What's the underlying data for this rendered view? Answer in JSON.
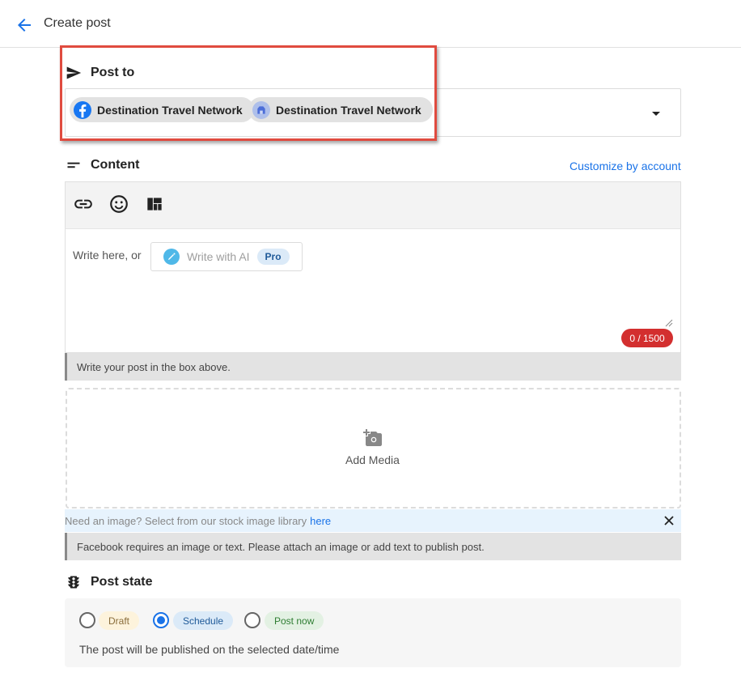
{
  "header": {
    "title": "Create post",
    "back_icon": "arrow-left-icon"
  },
  "post_to": {
    "heading": "Post to",
    "accounts": [
      {
        "name": "Destination Travel Network",
        "network": "facebook",
        "icon": "facebook-icon"
      },
      {
        "name": "Destination Travel Network",
        "network": "google-business",
        "icon": "google-business-icon"
      }
    ]
  },
  "content": {
    "heading": "Content",
    "customize_link": "Customize by account",
    "toolbar": [
      "link-icon",
      "emoji-icon",
      "layout-icon"
    ],
    "prompt": "Write here, or",
    "ai_button": "Write with AI",
    "ai_badge": "Pro",
    "counter": "0 / 1500",
    "notice": "Write your post in the box above."
  },
  "media": {
    "label": "Add Media",
    "stock_text": "Need an image? Select from our stock image library",
    "stock_link": "here",
    "warning": "Facebook requires an image or text. Please attach an image or add text to publish post."
  },
  "post_state": {
    "heading": "Post state",
    "options": [
      {
        "label": "Draft",
        "selected": false
      },
      {
        "label": "Schedule",
        "selected": true
      },
      {
        "label": "Post now",
        "selected": false
      }
    ],
    "description": "The post will be published on the selected date/time"
  },
  "colors": {
    "accent": "#1a73e8",
    "danger": "#d32f2f",
    "highlight": "#e04b3f"
  }
}
